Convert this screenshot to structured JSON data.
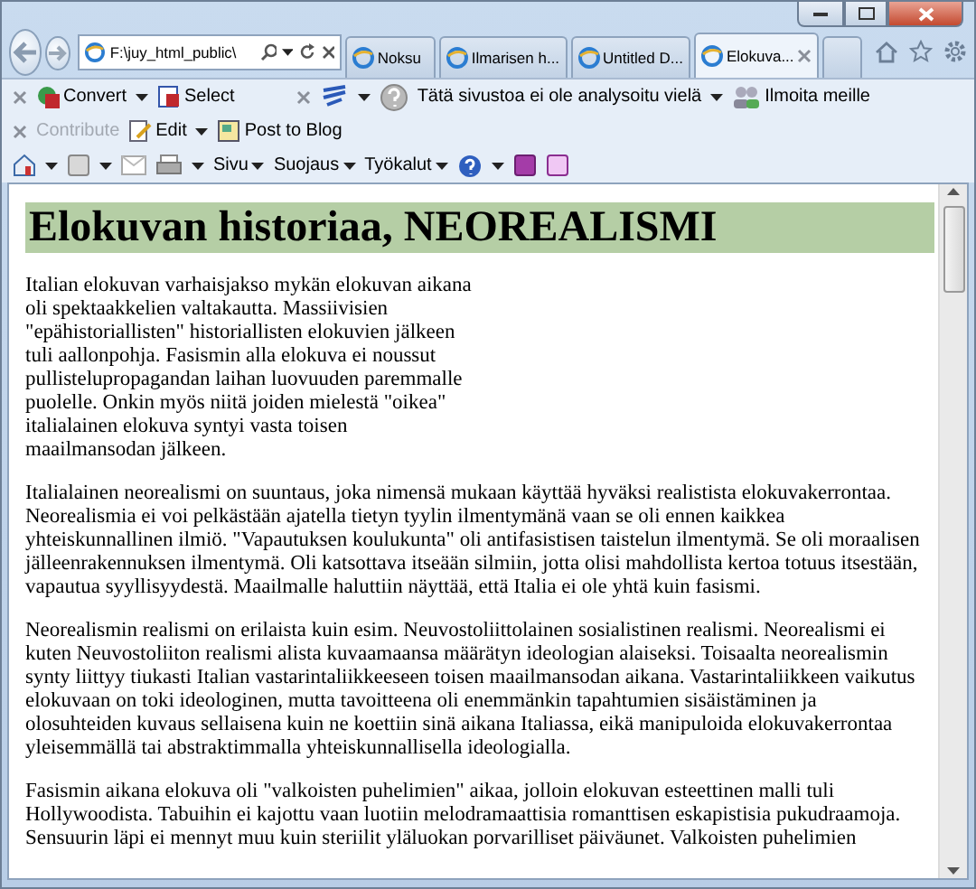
{
  "address_bar": {
    "value": "F:\\juy_html_public\\"
  },
  "tabs": [
    {
      "label": "Noksu",
      "selected": false
    },
    {
      "label": "Ilmarisen h...",
      "selected": false
    },
    {
      "label": "Untitled D...",
      "selected": false
    },
    {
      "label": "Elokuva...",
      "selected": true
    }
  ],
  "toolbar_1": {
    "convert": {
      "label": "Convert"
    },
    "select": {
      "label": "Select"
    },
    "site_status": {
      "label": "Tätä sivustoa ei ole analysoitu vielä"
    },
    "report": {
      "label": "Ilmoita meille"
    }
  },
  "toolbar_2": {
    "contribute": {
      "label": "Contribute",
      "disabled": true
    },
    "edit": {
      "label": "Edit",
      "disabled": false
    },
    "post_to_blog": {
      "label": "Post to Blog",
      "disabled": false
    }
  },
  "command_bar": {
    "menus": [
      {
        "label": "Sivu"
      },
      {
        "label": "Suojaus"
      },
      {
        "label": "Työkalut"
      }
    ]
  },
  "page": {
    "heading": "Elokuvan historiaa, NEOREALISMI",
    "paragraphs": [
      {
        "kind": "column",
        "text": "Italian elokuvan varhaisjakso mykän elokuvan aikana oli spektaakkelien valtakautta. Massiivisien \"epähistoriallisten\" historiallisten elokuvien jälkeen tuli aallonpohja. Fasismin alla elokuva ei noussut pullistelupropagandan laihan luovuuden paremmalle puolelle. Onkin myös niitä joiden mielestä \"oikea\" italialainen elokuva syntyi vasta toisen maailmansodan jälkeen."
      },
      {
        "kind": "full",
        "text": "Italialainen neorealismi on suuntaus, joka nimensä mukaan käyttää hyväksi realistista elokuvakerrontaa. Neorealismia ei voi pelkästään ajatella tietyn tyylin ilmentymänä vaan se oli ennen kaikkea yhteiskunnallinen ilmiö. \"Vapautuksen koulukunta\" oli antifasistisen taistelun ilmentymä. Se oli moraalisen jälleenrakennuksen ilmentymä. Oli katsottava itseään silmiin, jotta olisi mahdollista kertoa totuus itsestään, vapautua syyllisyydestä. Maailmalle haluttiin näyttää, että Italia ei ole yhtä kuin fasismi."
      },
      {
        "kind": "full",
        "text": "Neorealismin realismi on erilaista kuin esim. Neuvostoliittolainen sosialistinen realismi. Neorealismi ei kuten Neuvostoliiton realismi alista kuvaamaansa määrätyn ideologian alaiseksi. Toisaalta neorealismin synty liittyy tiukasti Italian vastarintaliikkeeseen toisen maailmansodan aikana. Vastarintaliikkeen vaikutus elokuvaan on toki ideologinen, mutta tavoitteena oli enemmänkin tapahtumien sisäistäminen ja olosuhteiden kuvaus sellaisena kuin ne koettiin sinä aikana Italiassa, eikä manipuloida elokuvakerrontaa yleisemmällä tai abstraktimmalla yhteiskunnallisella ideologialla."
      },
      {
        "kind": "full",
        "text": "Fasismin aikana elokuva oli \"valkoisten puhelimien\" aikaa, jolloin elokuvan esteettinen malli tuli Hollywoodista. Tabuihin ei kajottu vaan luotiin melodramaattisia romanttisen eskapistisia pukudraamoja. Sensuurin läpi ei mennyt muu kuin steriilit yläluokan porvarilliset päiväunet. Valkoisten puhelimien"
      }
    ]
  }
}
